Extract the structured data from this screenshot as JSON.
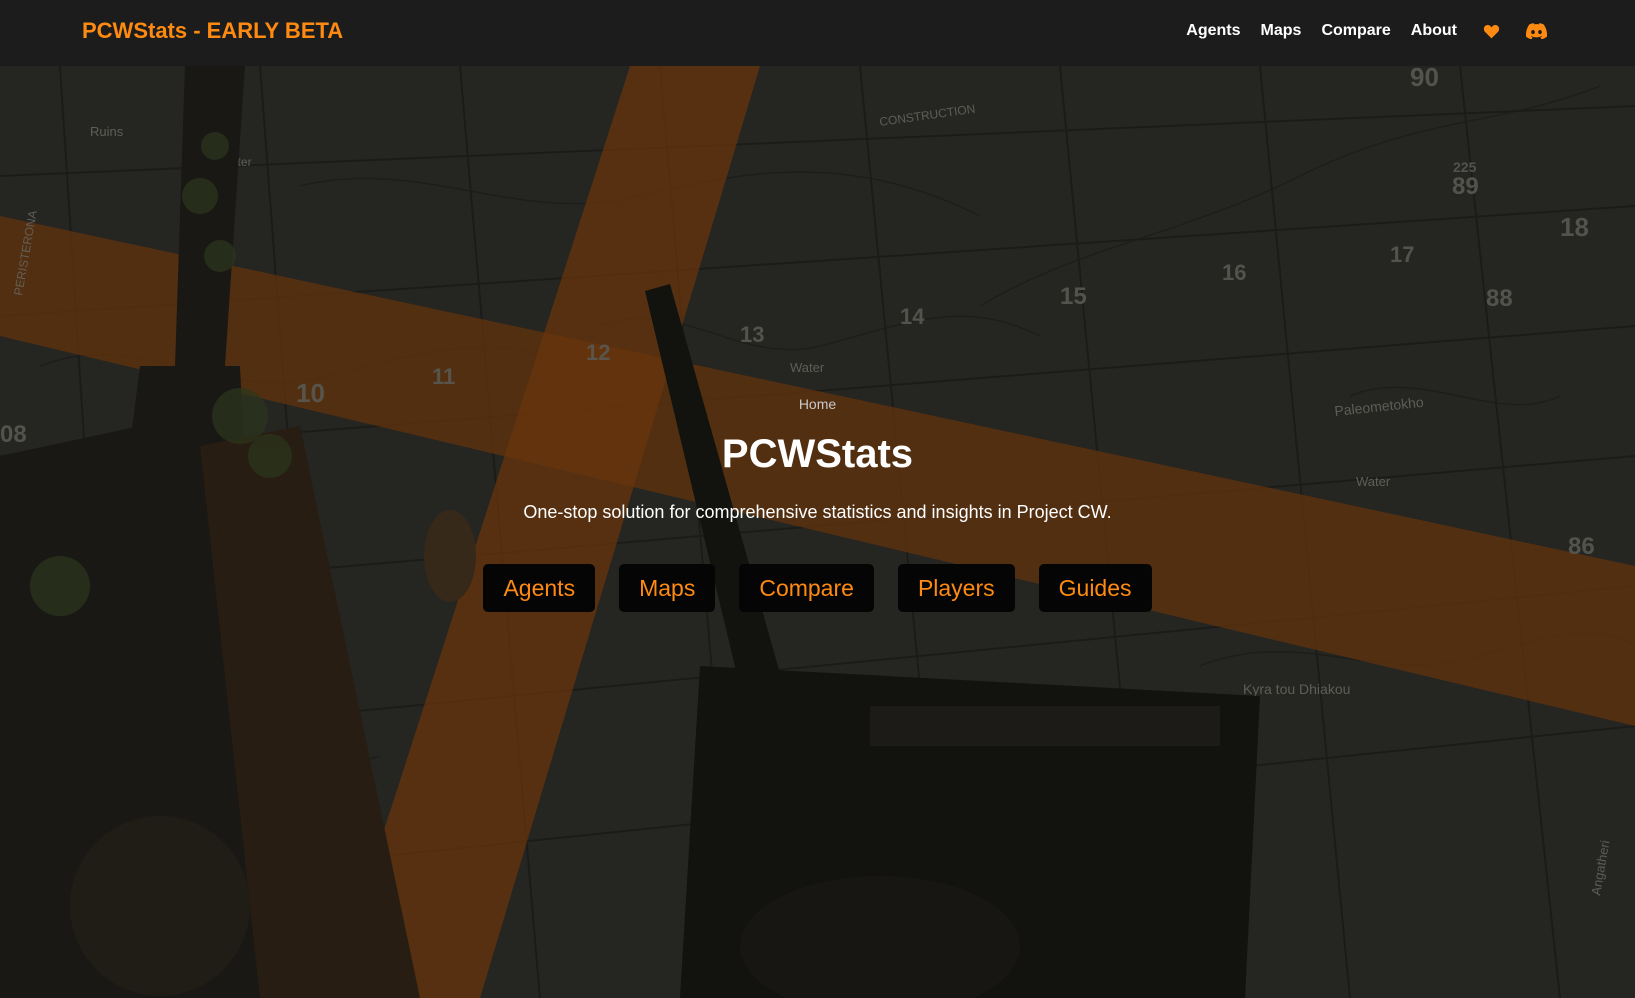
{
  "navbar": {
    "brand": "PCWStats - EARLY BETA",
    "links": [
      "Agents",
      "Maps",
      "Compare",
      "About"
    ],
    "heart_icon": "heart-icon",
    "discord_icon": "discord-icon"
  },
  "hero": {
    "breadcrumb": "Home",
    "title": "PCWStats",
    "subtitle": "One-stop solution for comprehensive statistics and insights in Project CW.",
    "buttons": [
      "Agents",
      "Maps",
      "Compare",
      "Players",
      "Guides"
    ],
    "map_labels": [
      "Ruins",
      "CONSTRUCTION",
      "PERISTERONA",
      "Water",
      "Paleometokho",
      "Water",
      "Kyra tou Dhiakou",
      "Angatheri",
      "Water"
    ],
    "map_numbers": [
      "90",
      "89",
      "225",
      "18",
      "17",
      "16",
      "15",
      "14",
      "13",
      "12",
      "11",
      "88",
      "86",
      "08",
      "10"
    ]
  },
  "colors": {
    "accent": "#ff8a12",
    "navbar_bg": "#1c1c1c",
    "button_bg": "#050505"
  }
}
